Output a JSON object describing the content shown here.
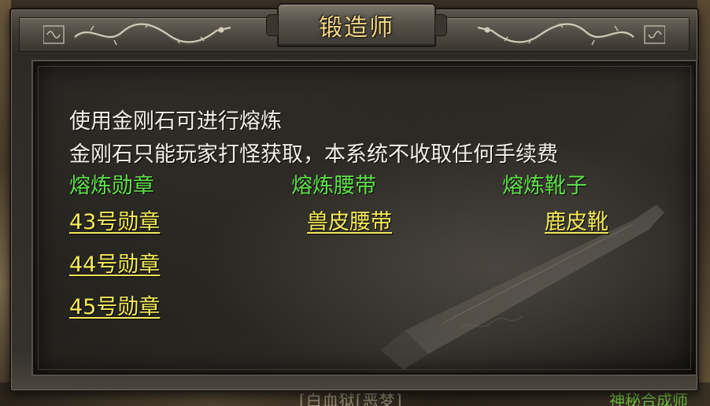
{
  "window": {
    "title": "锻造师"
  },
  "intro": {
    "line1": "使用金刚石可进行熔炼",
    "line2": "金刚石只能玩家打怪获取，本系统不收取任何手续费"
  },
  "columns": [
    {
      "header": "熔炼勋章",
      "items": [
        "43号勋章",
        "44号勋章",
        "45号勋章"
      ]
    },
    {
      "header": "熔炼腰带",
      "items": [
        "兽皮腰带"
      ]
    },
    {
      "header": "熔炼靴子",
      "items": [
        "鹿皮靴"
      ]
    }
  ],
  "background": {
    "bottom_left_text": "[白血狱[恶梦]",
    "bottom_right_text": "神秘合成师"
  },
  "colors": {
    "title": "#f2d98a",
    "text": "#f4f1ea",
    "category": "#5fe04a",
    "link": "#f6ec5a"
  }
}
